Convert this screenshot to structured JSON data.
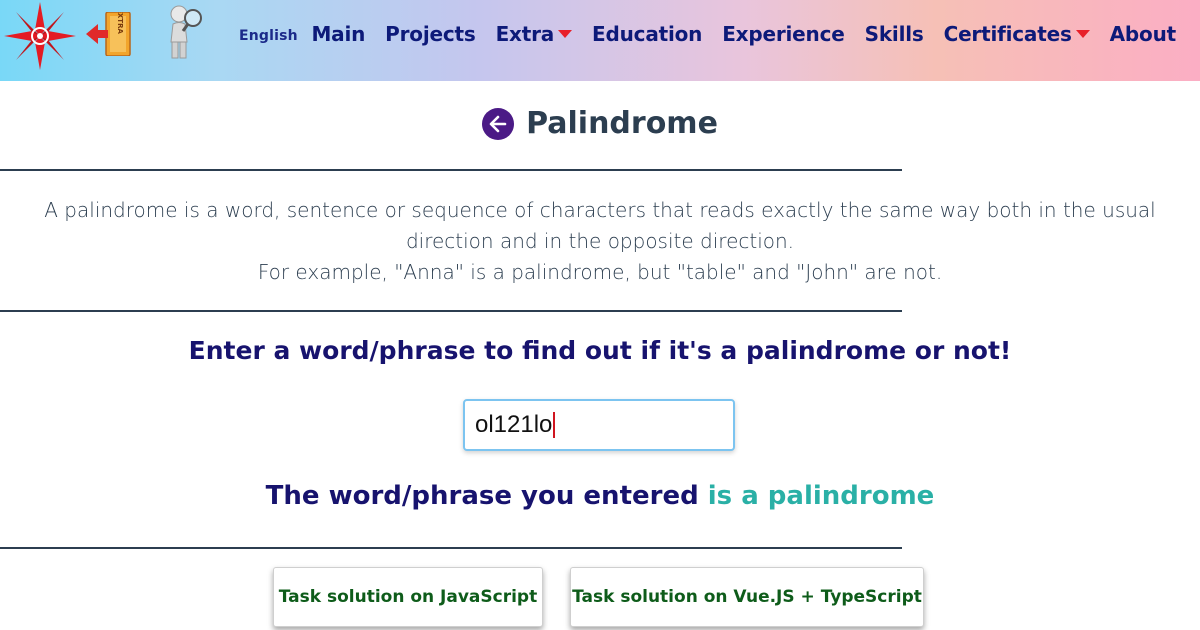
{
  "header": {
    "language": "English",
    "nav": [
      {
        "label": "Main",
        "dropdown": false
      },
      {
        "label": "Projects",
        "dropdown": false
      },
      {
        "label": "Extra",
        "dropdown": true
      },
      {
        "label": "Education",
        "dropdown": false
      },
      {
        "label": "Experience",
        "dropdown": false
      },
      {
        "label": "Skills",
        "dropdown": false
      },
      {
        "label": "Certificates",
        "dropdown": true
      },
      {
        "label": "About",
        "dropdown": false
      }
    ],
    "icons": [
      "compass-logo-icon",
      "extra-exit-icon",
      "magnifier-figure-icon"
    ]
  },
  "main": {
    "title": "Palindrome",
    "description_line1": "A palindrome is a word, sentence or sequence of characters that reads exactly the same way both in the usual direction and in the opposite direction.",
    "description_line2": "For example, \"Anna\" is a palindrome, but \"table\" and \"John\" are not.",
    "prompt": "Enter a word/phrase to find out if it's a palindrome or not!",
    "input_value": "ol121lo",
    "result_prefix": "The word/phrase you entered",
    "result_verdict": "is a palindrome",
    "buttons": {
      "js": "Task solution on JavaScript",
      "vue": "Task solution on Vue.JS + TypeScript"
    }
  },
  "colors": {
    "nav_text": "#0d1a79",
    "dropdown_caret": "#e8202a",
    "back_button": "#4b1a86",
    "prompt_text": "#17136e",
    "verdict_text": "#2ab0a6",
    "button_text": "#0e5c1a"
  }
}
